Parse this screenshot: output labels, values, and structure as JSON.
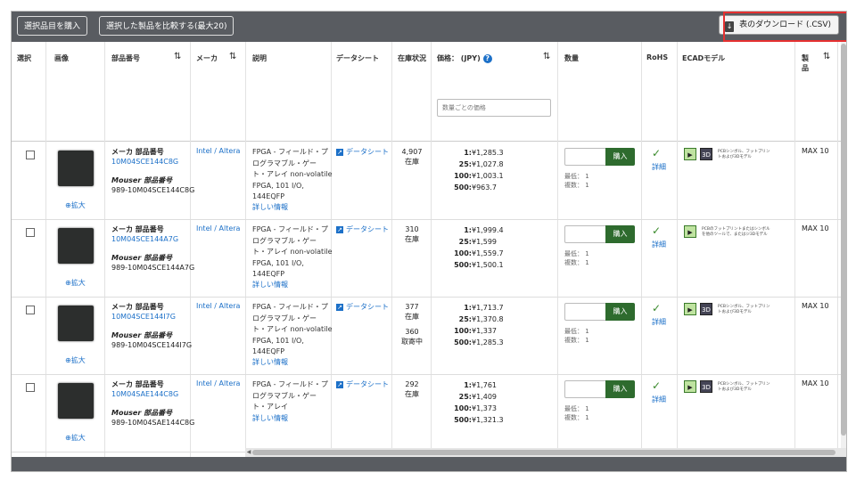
{
  "toolbar": {
    "buy_selected": "選択品目を購入",
    "compare_selected": "選択した製品を比較する(最大20)",
    "download_csv": "表のダウンロード (.CSV)"
  },
  "headers": {
    "select": "選択",
    "image": "画像",
    "part_number": "部品番号",
    "maker": "メーカ",
    "description": "説明",
    "datasheet": "データシート",
    "stock": "在庫状況",
    "price": "価格： (JPY)",
    "price_placeholder": "数量ごとの価格",
    "quantity": "数量",
    "rohs": "RoHS",
    "ecad": "ECADモデル",
    "series_top": "製",
    "series_bottom": "品"
  },
  "common": {
    "zoom": "拡大",
    "maker_pn_label": "メーカ 部品番号",
    "mouser_pn_label": "Mouser 部品番号",
    "maker_name": "Intel / Altera",
    "datasheet_link": "データシート",
    "more_info": "詳しい情報",
    "buy": "購入",
    "min_label": "最低： 1",
    "mult_label": "複数： 1",
    "rohs_detail": "詳細",
    "series": "MAX 10",
    "ecad_text_a": "PCBシンボル、フットプリントおよび3Dモデル",
    "ecad_text_b": "PCBのフットプリントまたはシンボルを他のツールで、またはジ3Dモデル"
  },
  "rows": [
    {
      "maker_pn": "10M04SCE144C8G",
      "mouser_pn": "989-10M04SCE144C8G",
      "desc_1": "FPGA - フィールド・プ",
      "desc_2": "ログラマブル・ゲー",
      "desc_3": "ト・アレイ non-volatile",
      "desc_4": "FPGA, 101 I/O,",
      "desc_5": "144EQFP",
      "stock_qty": "4,907",
      "stock_label": "在庫",
      "stock_extra_qty": "",
      "stock_extra_label": "",
      "p1_label": "1:",
      "p1": "¥1,285.3",
      "p2_label": "25:",
      "p2": "¥1,027.8",
      "p3_label": "100:",
      "p3": "¥1,003.1",
      "p4_label": "500:",
      "p4": "¥963.7"
    },
    {
      "maker_pn": "10M04SCE144A7G",
      "mouser_pn": "989-10M04SCE144A7G",
      "desc_1": "FPGA - フィールド・プ",
      "desc_2": "ログラマブル・ゲー",
      "desc_3": "ト・アレイ non-volatile",
      "desc_4": "FPGA, 101 I/O,",
      "desc_5": "144EQFP",
      "stock_qty": "310",
      "stock_label": "在庫",
      "stock_extra_qty": "",
      "stock_extra_label": "",
      "p1_label": "1:",
      "p1": "¥1,999.4",
      "p2_label": "25:",
      "p2": "¥1,599",
      "p3_label": "100:",
      "p3": "¥1,559.7",
      "p4_label": "500:",
      "p4": "¥1,500.1"
    },
    {
      "maker_pn": "10M04SCE144I7G",
      "mouser_pn": "989-10M04SCE144I7G",
      "desc_1": "FPGA - フィールド・プ",
      "desc_2": "ログラマブル・ゲー",
      "desc_3": "ト・アレイ non-volatile",
      "desc_4": "FPGA, 101 I/O,",
      "desc_5": "144EQFP",
      "stock_qty": "377",
      "stock_label": "在庫",
      "stock_extra_qty": "360",
      "stock_extra_label": "取寄中",
      "p1_label": "1:",
      "p1": "¥1,713.7",
      "p2_label": "25:",
      "p2": "¥1,370.8",
      "p3_label": "100:",
      "p3": "¥1,337",
      "p4_label": "500:",
      "p4": "¥1,285.3"
    },
    {
      "maker_pn": "10M04SAE144C8G",
      "mouser_pn": "989-10M04SAE144C8G",
      "desc_1": "FPGA - フィールド・プ",
      "desc_2": "ログラマブル・ゲー",
      "desc_3": "ト・アレイ",
      "desc_4": "",
      "desc_5": "",
      "stock_qty": "292",
      "stock_label": "在庫",
      "stock_extra_qty": "",
      "stock_extra_label": "",
      "p1_label": "1:",
      "p1": "¥1,761",
      "p2_label": "25:",
      "p2": "¥1,409",
      "p3_label": "100:",
      "p3": "¥1,373",
      "p4_label": "500:",
      "p4": "¥1,321.3"
    }
  ]
}
